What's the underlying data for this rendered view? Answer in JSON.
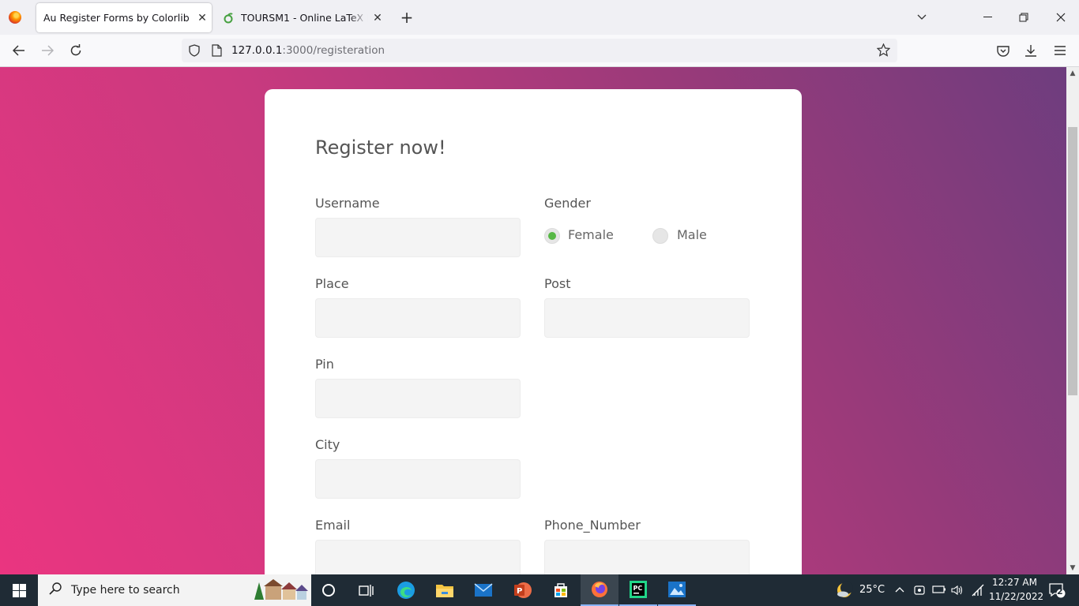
{
  "browser": {
    "tabs": [
      {
        "title": "Au Register Forms by Colorlib",
        "active": true
      },
      {
        "title": "TOURSM1 - Online LaTeX Editor",
        "active": false
      }
    ],
    "url_host": "127.0.0.1",
    "url_path": ":3000/registeration"
  },
  "form": {
    "title": "Register now!",
    "labels": {
      "username": "Username",
      "gender": "Gender",
      "place": "Place",
      "post": "Post",
      "pin": "Pin",
      "city": "City",
      "email": "Email",
      "phone": "Phone_Number"
    },
    "gender_options": [
      "Female",
      "Male"
    ],
    "gender_selected": "Female",
    "accent_color": "#57b846"
  },
  "taskbar": {
    "search_placeholder": "Type here to search",
    "weather": "25°C",
    "time": "12:27 AM",
    "date": "11/22/2022",
    "notification_count": "2"
  }
}
